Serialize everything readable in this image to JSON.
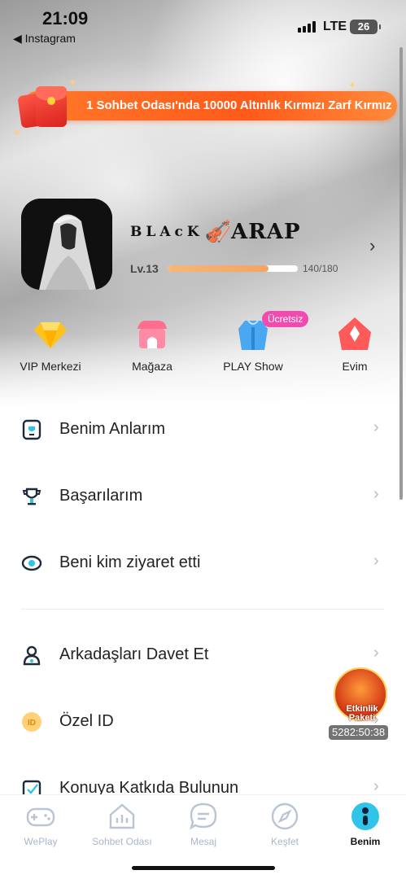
{
  "status_bar": {
    "time": "21:09",
    "back_app": "◀ Instagram",
    "network": "LTE",
    "battery": "26"
  },
  "banner": {
    "text": "1 Sohbet Odası'nda 10000 Altınlık Kırmızı Zarf Kırmız"
  },
  "profile": {
    "name_part1": "BLAcK",
    "name_part2": "ARAP",
    "level": "Lv.13",
    "xp_text": "140/180",
    "xp_current": 140,
    "xp_max": 180
  },
  "quick_actions": [
    {
      "label": "VIP Merkezi",
      "icon": "diamond-icon"
    },
    {
      "label": "Mağaza",
      "icon": "store-icon"
    },
    {
      "label": "PLAY Show",
      "icon": "outfit-icon",
      "badge": "Ücretsiz"
    },
    {
      "label": "Evim",
      "icon": "house-icon"
    }
  ],
  "menu": [
    {
      "label": "Benim Anlarım",
      "icon": "moments-icon"
    },
    {
      "label": "Başarılarım",
      "icon": "trophy-icon"
    },
    {
      "label": "Beni kim ziyaret etti",
      "icon": "eye-icon"
    },
    {
      "label": "Arkadaşları Davet Et",
      "icon": "invite-user-icon"
    },
    {
      "label": "Özel ID",
      "icon": "id-badge-icon"
    },
    {
      "label": "Konuya Katkıda Bulunun",
      "icon": "contribute-icon"
    }
  ],
  "event": {
    "label": "Etkinlik Paketi",
    "timer": "5282:50:38"
  },
  "tabs": [
    {
      "label": "WePlay",
      "icon": "gamepad-icon",
      "active": false
    },
    {
      "label": "Sohbet Odası",
      "icon": "chat-room-icon",
      "active": false
    },
    {
      "label": "Mesaj",
      "icon": "message-icon",
      "active": false
    },
    {
      "label": "Keşfet",
      "icon": "compass-icon",
      "active": false
    },
    {
      "label": "Benim",
      "icon": "profile-icon",
      "active": true
    }
  ],
  "colors": {
    "accent_orange": "#ff6a1f",
    "xp_fill": "#f4ad6c",
    "tab_inactive": "#a9b7c8",
    "tab_active_icon": "#2fc4e8",
    "badge_pink": "#f24bb0"
  }
}
